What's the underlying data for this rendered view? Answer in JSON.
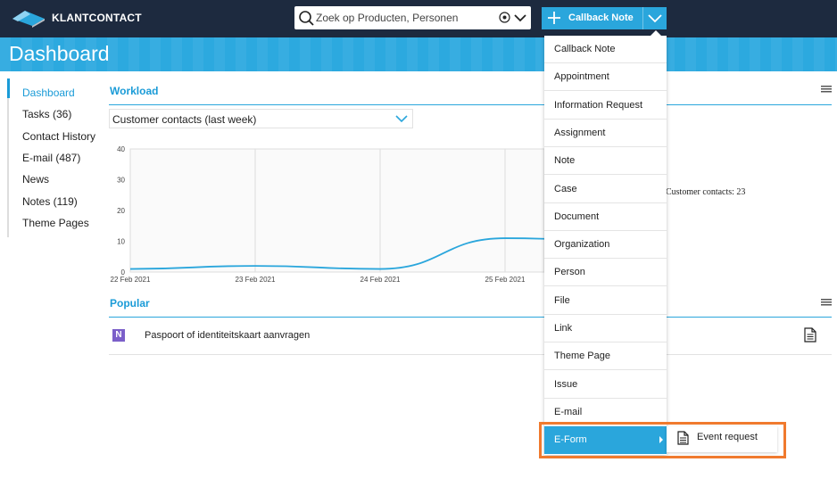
{
  "app": {
    "brand": "KLANTCONTACT"
  },
  "search": {
    "placeholder": "Zoek op Producten, Personen"
  },
  "toolbar": {
    "callback_label": "Callback Note"
  },
  "page": {
    "title": "Dashboard"
  },
  "sidebar": {
    "items": [
      {
        "label": "Dashboard",
        "active": true
      },
      {
        "label": "Tasks (36)"
      },
      {
        "label": "Contact History"
      },
      {
        "label": "E-mail (487)"
      },
      {
        "label": "News"
      },
      {
        "label": "Notes (119)"
      },
      {
        "label": "Theme Pages"
      }
    ]
  },
  "workload": {
    "title": "Workload",
    "select_value": "Customer contacts (last week)",
    "tooltip": "Customer contacts: 23"
  },
  "chart_data": {
    "type": "line",
    "x": [
      "22 Feb 2021",
      "23 Feb 2021",
      "24 Feb 2021",
      "25 Feb 2021"
    ],
    "y_ticks": [
      0,
      10,
      20,
      30,
      40
    ],
    "ylim": [
      0,
      40
    ],
    "series": [
      {
        "values": [
          1,
          2,
          1,
          11,
          10
        ]
      }
    ],
    "grid": true,
    "color": "#2aa6dc"
  },
  "popular": {
    "title": "Popular",
    "items": [
      {
        "badge": "N",
        "label": "Paspoort of identiteitskaart aanvragen"
      }
    ]
  },
  "menu": {
    "items": [
      "Callback Note",
      "Appointment",
      "Information Request",
      "Assignment",
      "Note",
      "Case",
      "Document",
      "Organization",
      "Person",
      "File",
      "Link",
      "Theme Page",
      "Issue",
      "E-mail",
      "E-Form"
    ],
    "selected": "E-Form",
    "submenu": {
      "label": "Event request"
    }
  },
  "colors": {
    "accent": "#2aa6dc",
    "topbar": "#1d2a3f",
    "highlight": "#f07a2e",
    "badge": "#7b5fc9"
  }
}
